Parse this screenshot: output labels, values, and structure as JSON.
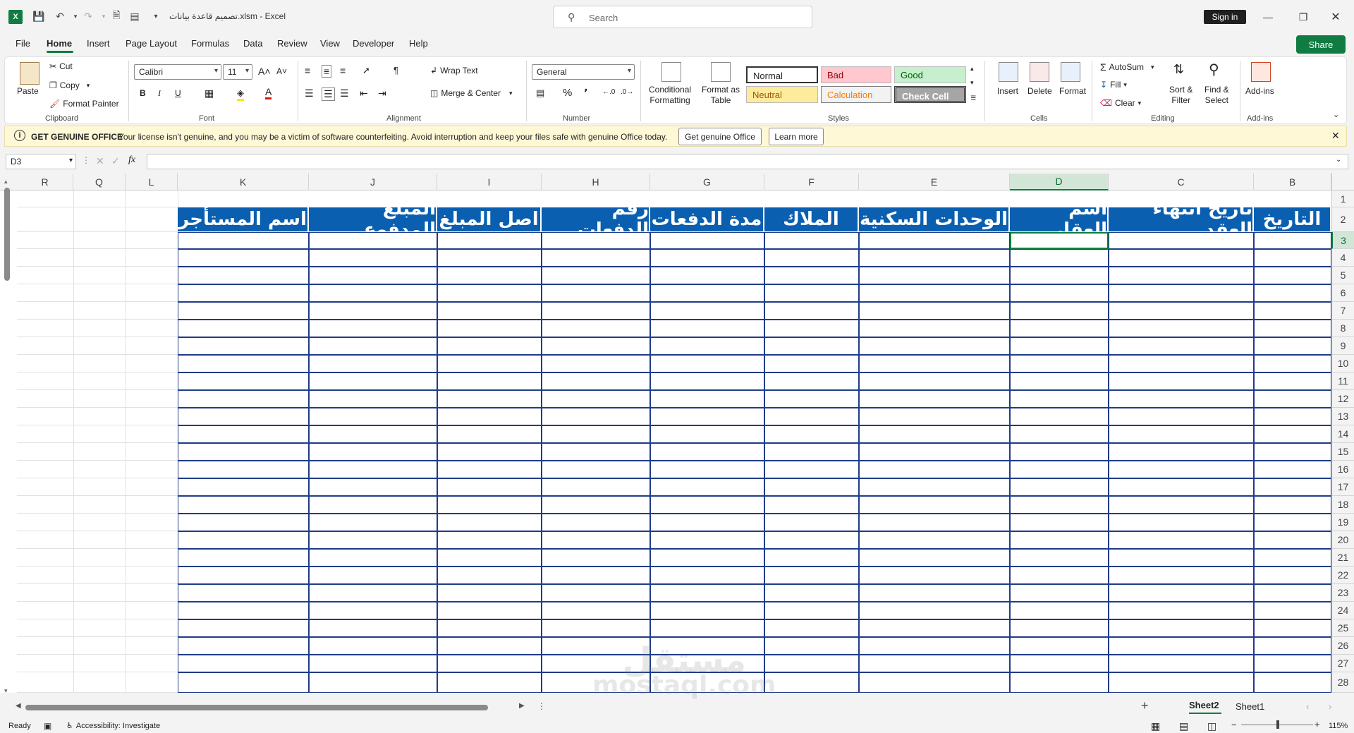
{
  "titlebar": {
    "doc_title": "تصميم قاعدة بيانات.xlsm  -  Excel",
    "search_placeholder": "Search",
    "signin_label": "Sign in"
  },
  "menu": {
    "tabs": [
      "File",
      "Home",
      "Insert",
      "Page Layout",
      "Formulas",
      "Data",
      "Review",
      "View",
      "Developer",
      "Help"
    ],
    "share_label": "Share"
  },
  "ribbon": {
    "clipboard": {
      "paste": "Paste",
      "cut": "Cut",
      "copy": "Copy",
      "format_painter": "Format Painter",
      "label": "Clipboard"
    },
    "font": {
      "name": "Calibri",
      "size": "11",
      "label": "Font"
    },
    "alignment": {
      "wrap_text": "Wrap Text",
      "merge_center": "Merge & Center",
      "label": "Alignment"
    },
    "number": {
      "format": "General",
      "label": "Number"
    },
    "styles": {
      "conditional": "Conditional",
      "formatting": "Formatting",
      "format_as": "Format as",
      "table": "Table",
      "normal": "Normal",
      "bad": "Bad",
      "good": "Good",
      "neutral": "Neutral",
      "calculation": "Calculation",
      "check_cell": "Check Cell",
      "label": "Styles"
    },
    "cells": {
      "insert": "Insert",
      "delete": "Delete",
      "format": "Format",
      "label": "Cells"
    },
    "editing": {
      "autosum": "AutoSum",
      "fill": "Fill",
      "clear": "Clear",
      "sort_filter_1": "Sort &",
      "sort_filter_2": "Filter",
      "find_select_1": "Find &",
      "find_select_2": "Select",
      "label": "Editing"
    },
    "addins": {
      "addins": "Add-ins",
      "label": "Add-ins"
    }
  },
  "infobar": {
    "title": "GET GENUINE OFFICE",
    "message": "Your license isn't genuine, and you may be a victim of software counterfeiting. Avoid interruption and keep your files safe with genuine Office today.",
    "get_genuine": "Get genuine Office",
    "learn_more": "Learn more"
  },
  "formula_bar": {
    "name_box": "D3",
    "formula": ""
  },
  "grid": {
    "columns": [
      "R",
      "Q",
      "L",
      "K",
      "J",
      "I",
      "H",
      "G",
      "F",
      "E",
      "D",
      "C",
      "B"
    ],
    "selected_column": "D",
    "rows": [
      "1",
      "2",
      "3",
      "4",
      "5",
      "6",
      "7",
      "8",
      "9",
      "10",
      "11",
      "12",
      "13",
      "14",
      "15",
      "16",
      "17",
      "18",
      "19",
      "20",
      "21",
      "22",
      "23",
      "24",
      "25",
      "26",
      "27",
      "28"
    ],
    "selected_row": "3",
    "headers": [
      "اسم المستأجر",
      "المبلغ المدفوع",
      "اصل المبلغ",
      "رقم الدفعات",
      "مدة الدفعات",
      "الملاك",
      "الوحدات السكنية",
      "اسم العقار",
      "تاريخ انتهاء العقد",
      "التاريخ"
    ],
    "colors": {
      "header_fill": "#0a5fb0",
      "border": "#1f3c88",
      "accent": "#107c41"
    }
  },
  "sheets": {
    "tabs": [
      "Sheet2",
      "Sheet1"
    ],
    "active": "Sheet2"
  },
  "status": {
    "ready": "Ready",
    "accessibility": "Accessibility: Investigate",
    "zoom": "115%"
  },
  "watermark": {
    "text_ar": "مستقل",
    "text_en": "mostaql.com"
  }
}
